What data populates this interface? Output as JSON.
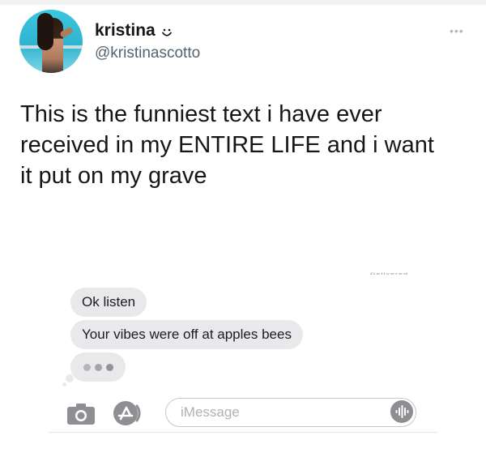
{
  "tweet": {
    "author": {
      "display_name": "kristina",
      "handle": "@kristinascotto",
      "name_emoji_icon": "smile-icon",
      "avatar_icon": "profile-photo"
    },
    "more_icon": "more-dots-icon",
    "text_lines": [
      "This is the funniest text i have ever",
      "received in my ENTIRE LIFE and i want",
      "it put on my grave"
    ]
  },
  "screenshot": {
    "delivered_label": "Delivered",
    "messages": [
      {
        "text": "Ok listen",
        "direction": "incoming"
      },
      {
        "text": "Your vibes were off at apples bees",
        "direction": "incoming"
      }
    ],
    "typing_indicator": true,
    "input_bar": {
      "camera_icon": "camera-icon",
      "appstore_icon": "app-store-icon",
      "placeholder": "iMessage",
      "audio_icon": "audio-waveform-icon"
    }
  },
  "colors": {
    "bubble_gray": "#e9e9eb",
    "text_dark": "#14171a",
    "handle_gray": "#536471",
    "icon_gray": "#8e8e93"
  }
}
